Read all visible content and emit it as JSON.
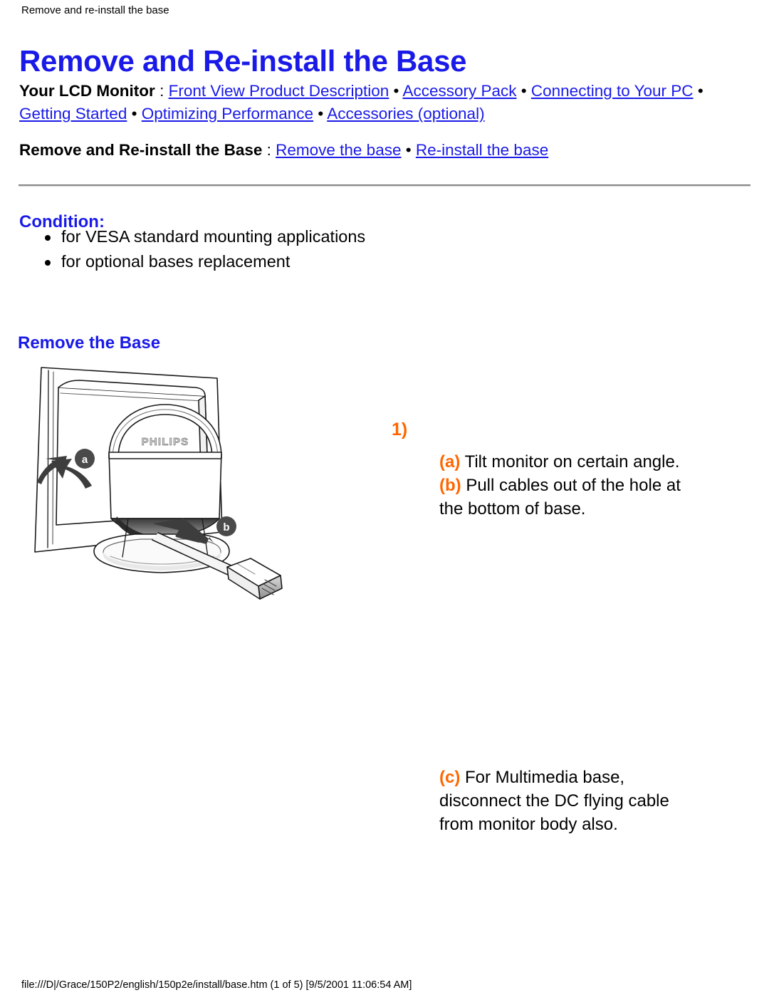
{
  "header_note": "Remove and re-install the base",
  "page_title": "Remove and Re-install the Base",
  "nav": {
    "lead": "Your LCD Monitor",
    "colon": " : ",
    "bullet": " • ",
    "links": [
      "Front View Product Description",
      "Accessory Pack",
      "Connecting to Your PC",
      "Getting Started",
      "Optimizing Performance",
      "Accessories (optional)"
    ]
  },
  "nav2": {
    "lead": "Remove and Re-install the Base",
    "colon": " : ",
    "bullet": " • ",
    "links": [
      "Remove the base",
      "Re-install the base"
    ]
  },
  "condition": {
    "heading": "Condition:",
    "items": [
      "for VESA standard mounting applications",
      "for optional bases replacement"
    ]
  },
  "section": {
    "heading": "Remove the Base"
  },
  "figure": {
    "brand_text": "PHILIPS",
    "callout_a": "a",
    "callout_b": "b",
    "alt": "Rear view of LCD monitor tilted on its base with arrows showing tilt direction (a) and cable pull direction (b)"
  },
  "steps": {
    "number": "1)",
    "step_a_label": "(a)",
    "step_a_text": " Tilt monitor on certain angle.",
    "step_b_label": "(b)",
    "step_b_text": " Pull cables out of the hole at the bottom of base.",
    "step_c_label": "(c)",
    "step_c_text": " For Multimedia base, disconnect the DC flying cable from monitor body also."
  },
  "footer": "file:///D|/Grace/150P2/english/150p2e/install/base.htm (1 of 5) [9/5/2001 11:06:54 AM]",
  "colors": {
    "link": "#1a1aE8",
    "heading": "#1a1aE8",
    "accent_orange": "#FF6600",
    "text": "#000000",
    "background": "#FFFFFF"
  }
}
